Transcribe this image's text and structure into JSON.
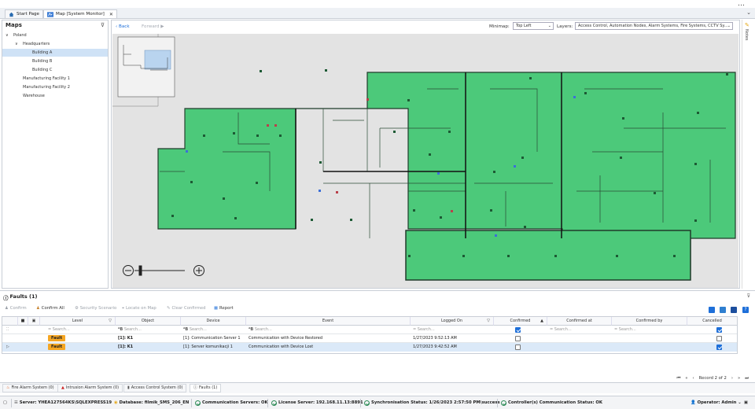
{
  "window": {
    "more_icon": "…"
  },
  "tabs": [
    {
      "label": "Start Page",
      "icon": "home-icon"
    },
    {
      "label": "Map [System Monitor]",
      "icon": "map-icon",
      "close": "✕"
    }
  ],
  "maps_panel": {
    "title": "Maps",
    "tree": [
      {
        "label": "Poland",
        "expander": "∨"
      },
      {
        "label": "Headquarters",
        "expander": "∨"
      },
      {
        "label": "Building A",
        "selected": true
      },
      {
        "label": "Building B"
      },
      {
        "label": "Building C"
      },
      {
        "label": "Manufacturing Facility 1"
      },
      {
        "label": "Manufacturing Facility 2"
      },
      {
        "label": "Warehouse"
      }
    ]
  },
  "map_toolbar": {
    "back": "‹ Back",
    "forward": "Forward",
    "minimap_label": "Minimap:",
    "minimap_value": "Top Left",
    "layers_label": "Layers:",
    "layers_value": "Access Control, Automation Nodes, Alarm Systems, Fire Systems, CCTV Sy..."
  },
  "notes": {
    "label": "Notes"
  },
  "zoom": {
    "minus": "−",
    "plus": "+",
    "level": 0.12
  },
  "faults": {
    "title": "Faults (1)",
    "toolbar": {
      "confirm": "Confirm",
      "confirm_all": "Confirm All",
      "security_scenario": "Security Scenario",
      "locate_on_map": "Locate on Map",
      "clear_confirmed": "Clear Confirmed",
      "report": "Report"
    },
    "columns": [
      "Level",
      "Object",
      "Device",
      "Event",
      "Logged On",
      "Confirmed",
      "Confirmed at",
      "Confirmed by",
      "Cancelled"
    ],
    "search_placeholder": "Search...",
    "rows": [
      {
        "level": "Fault",
        "object": "[1]: K1",
        "device": "[1]: Communication Server 1",
        "event": "Communication with Device Restored",
        "logged_on": "1/27/2023 9:52:13 AM",
        "confirmed": false,
        "cancelled": false
      },
      {
        "level": "Fault",
        "object": "[1]: K1",
        "device": "[1]: Server komunikacji 1",
        "event": "Communication with Device Lost",
        "logged_on": "1/27/2023 9:42:52 AM",
        "confirmed": false,
        "cancelled": true
      }
    ],
    "pager": {
      "first": "⏮",
      "prev_page": "«",
      "prev": "‹",
      "record": "Record 2 of 2",
      "next": "›",
      "next_page": "»",
      "last": "⏭"
    }
  },
  "bottom_tabs": [
    {
      "label": "Fire Alarm System (0)",
      "icon": "fire-icon"
    },
    {
      "label": "Intrusion Alarm System (0)",
      "icon": "intrusion-icon"
    },
    {
      "label": "Access Control System (0)",
      "icon": "access-icon"
    },
    {
      "label": "Faults (1)",
      "icon": "fault-icon",
      "active": true
    }
  ],
  "status": {
    "server": "Server: YHEA127564KS\\SQLEXPRESS19",
    "database": "Database: filmik_SMS_206_EN",
    "comm_servers": "Communication Servers: OK",
    "license": "License Server: 192.168.11.13:8891",
    "sync": "Synchronisation Status: 1/26/2023 2:57:50 PM\\success",
    "controllers": "Controller(s) Communication Status: OK",
    "operator": "Operator: Admin ⌄"
  },
  "colors": {
    "floor": "#4cc97a",
    "floor_border": "#1f3b2a",
    "selection": "#cfe2f6",
    "fault": "#f5a623",
    "accent": "#1e6fd9"
  }
}
